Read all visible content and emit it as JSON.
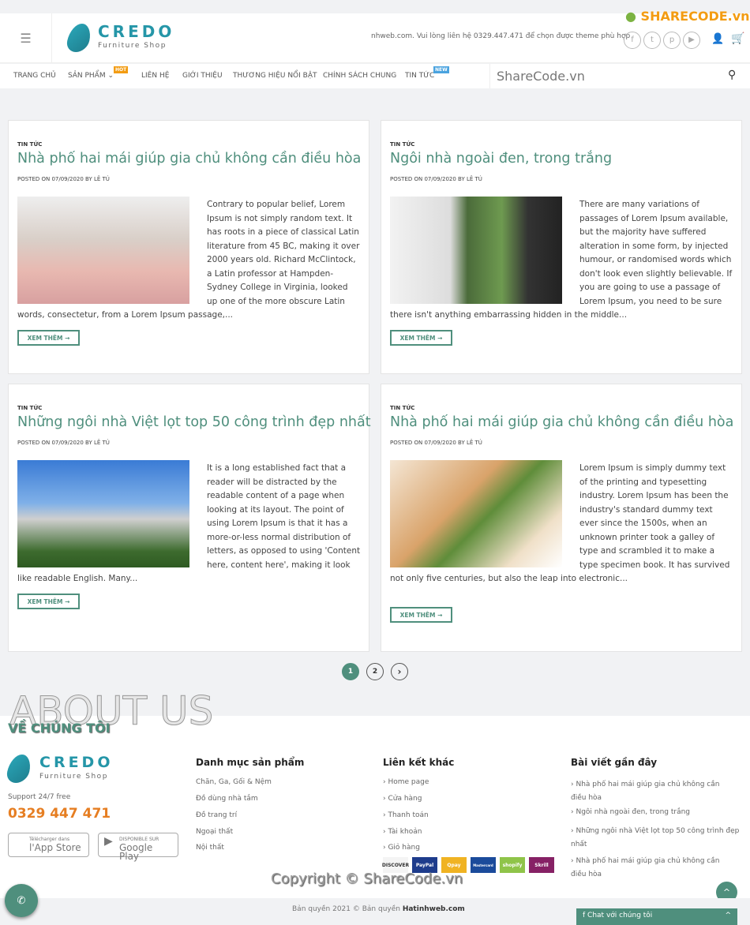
{
  "header": {
    "logo_title": "CREDO",
    "logo_subtitle": "Furniture Shop",
    "top_message": "nhweb.com. Vui lòng liên hệ 0329.447.471 để chọn được theme phù hợp",
    "social_icons": [
      "facebook-icon",
      "twitter-icon",
      "pinterest-icon",
      "youtube-icon"
    ],
    "watermark_logo": "SHARECODE.vn"
  },
  "nav": {
    "items": [
      {
        "label": "TRANG CHỦ"
      },
      {
        "label": "SẢN PHẨM",
        "badge": "HOT",
        "badge_color": "#f39c12"
      },
      {
        "label": "LIÊN HỆ"
      },
      {
        "label": "GIỚI THIỆU"
      },
      {
        "label": "THƯƠNG HIỆU NỔI BẬT"
      },
      {
        "label": "CHÍNH SÁCH CHUNG"
      },
      {
        "label": "TIN TỨC",
        "badge": "NEW",
        "badge_color": "#4aa3df"
      }
    ],
    "search_watermark": "ShareCode.vn"
  },
  "posts": [
    {
      "category": "TIN TỨC",
      "title": "Nhà phố hai mái giúp gia chủ không cần điều hòa",
      "meta": "POSTED ON 07/09/2020 BY LÊ TÚ",
      "excerpt": "Contrary to popular belief, Lorem Ipsum is not simply random text. It has roots in a piece of classical Latin literature from 45 BC, making it over 2000 years old. Richard McClintock, a Latin professor at Hampden-Sydney College in Virginia, looked up one of the more obscure Latin words, consectetur, from a Lorem Ipsum passage,...",
      "button": "XEM THÊM →"
    },
    {
      "category": "TIN TỨC",
      "title": "Ngôi nhà ngoài đen, trong trắng",
      "meta": "POSTED ON 07/09/2020 BY LÊ TÚ",
      "excerpt": "There are many variations of passages of Lorem Ipsum available, but the majority have suffered alteration in some form, by injected humour, or randomised words which don't look even slightly believable. If you are going to use a passage of Lorem Ipsum, you need to be sure there isn't anything embarrassing hidden in the middle...",
      "button": "XEM THÊM →"
    },
    {
      "category": "TIN TỨC",
      "title": "Những ngôi nhà Việt lọt top 50 công trình đẹp nhất",
      "meta": "POSTED ON 07/09/2020 BY LÊ TÚ",
      "excerpt": "It is a long established fact that a reader will be distracted by the readable content of a page when looking at its layout. The point of using Lorem Ipsum is that it has a more-or-less normal distribution of letters, as opposed to using 'Content here, content here', making it look like readable English. Many...",
      "button": "XEM THÊM →"
    },
    {
      "category": "TIN TỨC",
      "title": "Nhà phố hai mái giúp gia chủ không cần điều hòa",
      "meta": "POSTED ON 07/09/2020 BY LÊ TÚ",
      "excerpt": "Lorem Ipsum is simply dummy text of the printing and typesetting industry. Lorem Ipsum has been the industry's standard dummy text ever since the 1500s, when an unknown printer took a galley of type and scrambled it to make a type specimen book. It has survived not only five centuries, but also the leap into electronic...",
      "button": "XEM THÊM →"
    }
  ],
  "pagination": {
    "pages": [
      "1",
      "2"
    ],
    "current": "1"
  },
  "footer": {
    "about_bg": "ABOUT US",
    "about_title": "VỀ CHÚNG TÔI",
    "support": "Support 24/7 free",
    "phone": "0329 447 471",
    "appstore_small": "Télécharger dans",
    "appstore": "l'App Store",
    "googleplay_small": "DISPONIBLE SUR",
    "googleplay": "Google Play",
    "col1": {
      "title": "Danh mục sản phẩm",
      "items": [
        "Chăn, Ga, Gối & Nệm",
        "Đồ dùng nhà tắm",
        "Đồ trang trí",
        "Ngoại thất",
        "Nội thất"
      ]
    },
    "col2": {
      "title": "Liên kết khác",
      "items": [
        "› Home page",
        "› Cửa hàng",
        "› Thanh toán",
        "› Tài khoản",
        "› Giỏ hàng"
      ]
    },
    "col3": {
      "title": "Bài viết gần đây",
      "items": [
        "› Nhà phố hai mái giúp gia chủ không cần điều hòa",
        "› Ngôi nhà ngoài đen, trong trắng",
        "› Những ngôi nhà Việt lọt top 50 công trình đẹp nhất",
        "› Nhà phố hai mái giúp gia chủ không cần điều hòa"
      ]
    },
    "payments": [
      {
        "label": "DISCOVER",
        "color": "#f4f4f4"
      },
      {
        "label": "PayPal",
        "color": "#1e3c8c"
      },
      {
        "label": "Qpay",
        "color": "#f0b323"
      },
      {
        "label": "Mastercard",
        "color": "#1b4b9b"
      },
      {
        "label": "shopify",
        "color": "#8fc449"
      },
      {
        "label": "Skrill",
        "color": "#862165"
      }
    ],
    "watermark": "Copyright © ShareCode.vn"
  },
  "bottom": {
    "copyright_prefix": "Bản quyền 2021 © Bản quyền ",
    "copyright_site": "Hatinhweb.com",
    "chat": "Chat với chúng tôi"
  },
  "accent": "#4f8f7d"
}
